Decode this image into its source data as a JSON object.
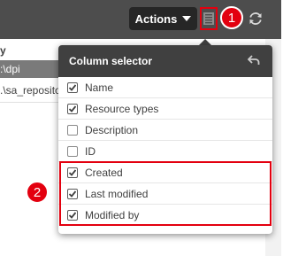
{
  "toolbar": {
    "actions_label": "Actions",
    "column_selector_icon": "column-selector-icon",
    "refresh_icon": "refresh-icon"
  },
  "callouts": {
    "one": "1",
    "two": "2"
  },
  "table_background": {
    "header_fragment": "y",
    "rows": [
      ":\\dpi",
      ".\\sa_reposito"
    ]
  },
  "popover": {
    "title": "Column selector",
    "back_icon": "back-arrow-icon",
    "items": [
      {
        "label": "Name",
        "checked": true
      },
      {
        "label": "Resource types",
        "checked": true
      },
      {
        "label": "Description",
        "checked": false
      },
      {
        "label": "ID",
        "checked": false
      },
      {
        "label": "Created",
        "checked": true
      },
      {
        "label": "Last modified",
        "checked": true
      },
      {
        "label": "Modified by",
        "checked": true
      }
    ]
  },
  "colors": {
    "highlight": "#e3000f",
    "topbar": "#4d4d4d",
    "popover_header": "#404040"
  }
}
